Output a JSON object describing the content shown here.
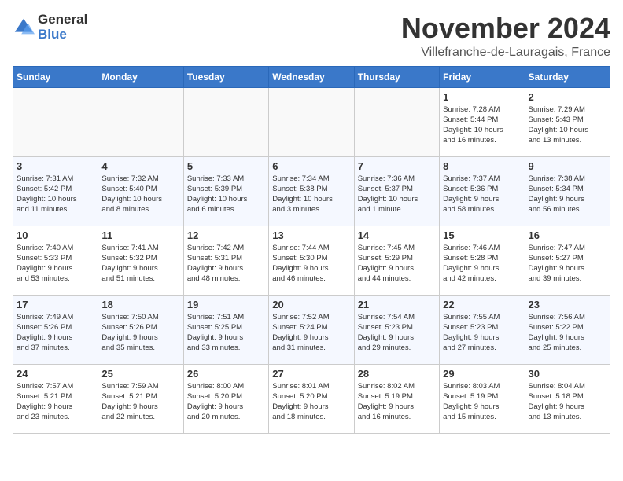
{
  "logo": {
    "line1": "General",
    "line2": "Blue"
  },
  "header": {
    "month_year": "November 2024",
    "location": "Villefranche-de-Lauragais, France"
  },
  "weekdays": [
    "Sunday",
    "Monday",
    "Tuesday",
    "Wednesday",
    "Thursday",
    "Friday",
    "Saturday"
  ],
  "weeks": [
    [
      {
        "day": "",
        "info": ""
      },
      {
        "day": "",
        "info": ""
      },
      {
        "day": "",
        "info": ""
      },
      {
        "day": "",
        "info": ""
      },
      {
        "day": "",
        "info": ""
      },
      {
        "day": "1",
        "info": "Sunrise: 7:28 AM\nSunset: 5:44 PM\nDaylight: 10 hours\nand 16 minutes."
      },
      {
        "day": "2",
        "info": "Sunrise: 7:29 AM\nSunset: 5:43 PM\nDaylight: 10 hours\nand 13 minutes."
      }
    ],
    [
      {
        "day": "3",
        "info": "Sunrise: 7:31 AM\nSunset: 5:42 PM\nDaylight: 10 hours\nand 11 minutes."
      },
      {
        "day": "4",
        "info": "Sunrise: 7:32 AM\nSunset: 5:40 PM\nDaylight: 10 hours\nand 8 minutes."
      },
      {
        "day": "5",
        "info": "Sunrise: 7:33 AM\nSunset: 5:39 PM\nDaylight: 10 hours\nand 6 minutes."
      },
      {
        "day": "6",
        "info": "Sunrise: 7:34 AM\nSunset: 5:38 PM\nDaylight: 10 hours\nand 3 minutes."
      },
      {
        "day": "7",
        "info": "Sunrise: 7:36 AM\nSunset: 5:37 PM\nDaylight: 10 hours\nand 1 minute."
      },
      {
        "day": "8",
        "info": "Sunrise: 7:37 AM\nSunset: 5:36 PM\nDaylight: 9 hours\nand 58 minutes."
      },
      {
        "day": "9",
        "info": "Sunrise: 7:38 AM\nSunset: 5:34 PM\nDaylight: 9 hours\nand 56 minutes."
      }
    ],
    [
      {
        "day": "10",
        "info": "Sunrise: 7:40 AM\nSunset: 5:33 PM\nDaylight: 9 hours\nand 53 minutes."
      },
      {
        "day": "11",
        "info": "Sunrise: 7:41 AM\nSunset: 5:32 PM\nDaylight: 9 hours\nand 51 minutes."
      },
      {
        "day": "12",
        "info": "Sunrise: 7:42 AM\nSunset: 5:31 PM\nDaylight: 9 hours\nand 48 minutes."
      },
      {
        "day": "13",
        "info": "Sunrise: 7:44 AM\nSunset: 5:30 PM\nDaylight: 9 hours\nand 46 minutes."
      },
      {
        "day": "14",
        "info": "Sunrise: 7:45 AM\nSunset: 5:29 PM\nDaylight: 9 hours\nand 44 minutes."
      },
      {
        "day": "15",
        "info": "Sunrise: 7:46 AM\nSunset: 5:28 PM\nDaylight: 9 hours\nand 42 minutes."
      },
      {
        "day": "16",
        "info": "Sunrise: 7:47 AM\nSunset: 5:27 PM\nDaylight: 9 hours\nand 39 minutes."
      }
    ],
    [
      {
        "day": "17",
        "info": "Sunrise: 7:49 AM\nSunset: 5:26 PM\nDaylight: 9 hours\nand 37 minutes."
      },
      {
        "day": "18",
        "info": "Sunrise: 7:50 AM\nSunset: 5:26 PM\nDaylight: 9 hours\nand 35 minutes."
      },
      {
        "day": "19",
        "info": "Sunrise: 7:51 AM\nSunset: 5:25 PM\nDaylight: 9 hours\nand 33 minutes."
      },
      {
        "day": "20",
        "info": "Sunrise: 7:52 AM\nSunset: 5:24 PM\nDaylight: 9 hours\nand 31 minutes."
      },
      {
        "day": "21",
        "info": "Sunrise: 7:54 AM\nSunset: 5:23 PM\nDaylight: 9 hours\nand 29 minutes."
      },
      {
        "day": "22",
        "info": "Sunrise: 7:55 AM\nSunset: 5:23 PM\nDaylight: 9 hours\nand 27 minutes."
      },
      {
        "day": "23",
        "info": "Sunrise: 7:56 AM\nSunset: 5:22 PM\nDaylight: 9 hours\nand 25 minutes."
      }
    ],
    [
      {
        "day": "24",
        "info": "Sunrise: 7:57 AM\nSunset: 5:21 PM\nDaylight: 9 hours\nand 23 minutes."
      },
      {
        "day": "25",
        "info": "Sunrise: 7:59 AM\nSunset: 5:21 PM\nDaylight: 9 hours\nand 22 minutes."
      },
      {
        "day": "26",
        "info": "Sunrise: 8:00 AM\nSunset: 5:20 PM\nDaylight: 9 hours\nand 20 minutes."
      },
      {
        "day": "27",
        "info": "Sunrise: 8:01 AM\nSunset: 5:20 PM\nDaylight: 9 hours\nand 18 minutes."
      },
      {
        "day": "28",
        "info": "Sunrise: 8:02 AM\nSunset: 5:19 PM\nDaylight: 9 hours\nand 16 minutes."
      },
      {
        "day": "29",
        "info": "Sunrise: 8:03 AM\nSunset: 5:19 PM\nDaylight: 9 hours\nand 15 minutes."
      },
      {
        "day": "30",
        "info": "Sunrise: 8:04 AM\nSunset: 5:18 PM\nDaylight: 9 hours\nand 13 minutes."
      }
    ]
  ]
}
